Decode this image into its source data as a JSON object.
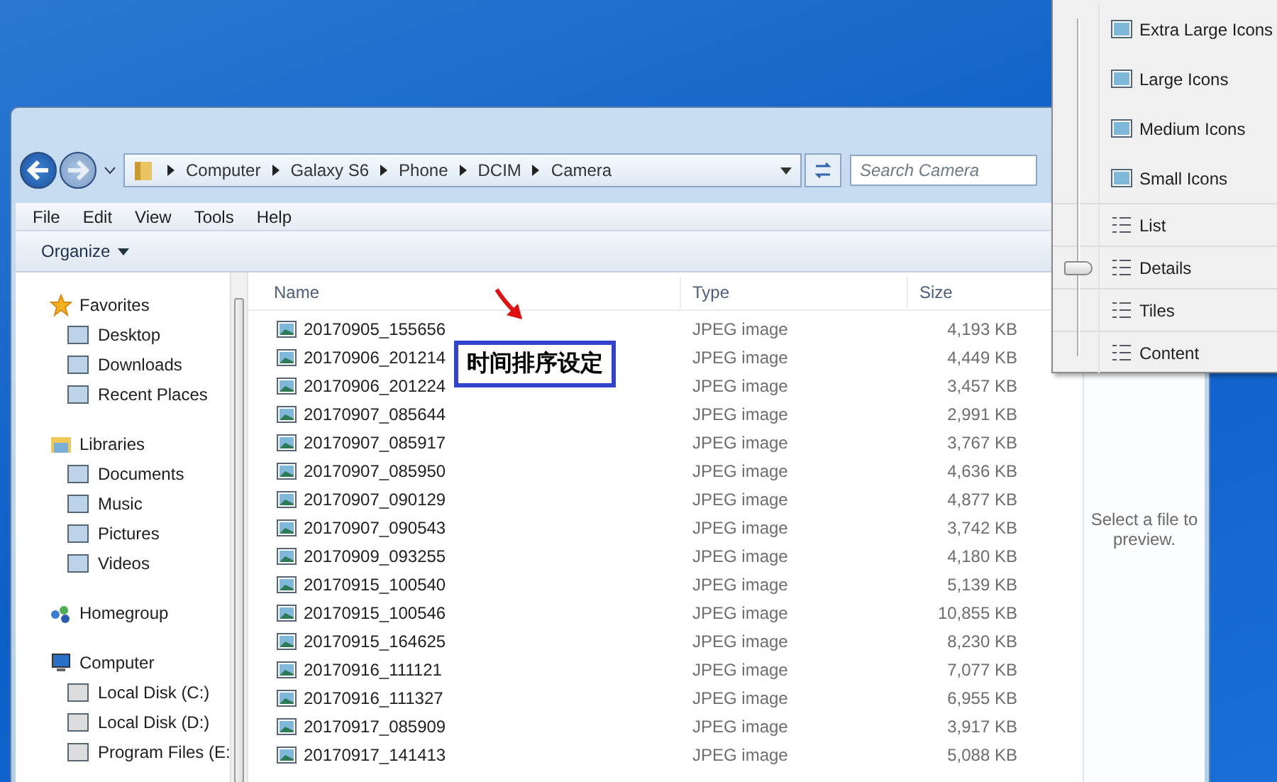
{
  "address_bar": {
    "path": [
      "Computer",
      "Galaxy S6",
      "Phone",
      "DCIM",
      "Camera"
    ]
  },
  "search": {
    "placeholder": "Search Camera"
  },
  "menu_bar": [
    "File",
    "Edit",
    "View",
    "Tools",
    "Help"
  ],
  "toolbar": {
    "organize": "Organize"
  },
  "nav_pane": [
    {
      "label": "Favorites",
      "children": [
        {
          "label": "Desktop"
        },
        {
          "label": "Downloads"
        },
        {
          "label": "Recent Places"
        }
      ]
    },
    {
      "label": "Libraries",
      "children": [
        {
          "label": "Documents"
        },
        {
          "label": "Music"
        },
        {
          "label": "Pictures"
        },
        {
          "label": "Videos"
        }
      ]
    },
    {
      "label": "Homegroup"
    },
    {
      "label": "Computer",
      "children": [
        {
          "label": "Local Disk (C:)"
        },
        {
          "label": "Local Disk (D:)"
        },
        {
          "label": "Program Files (E:"
        }
      ]
    }
  ],
  "table": {
    "columns": [
      "Name",
      "Type",
      "Size"
    ],
    "rows": [
      [
        "20170905_155656",
        "JPEG image",
        "4,193 KB"
      ],
      [
        "20170906_201214",
        "JPEG image",
        "4,449 KB"
      ],
      [
        "20170906_201224",
        "JPEG image",
        "3,457 KB"
      ],
      [
        "20170907_085644",
        "JPEG image",
        "2,991 KB"
      ],
      [
        "20170907_085917",
        "JPEG image",
        "3,767 KB"
      ],
      [
        "20170907_085950",
        "JPEG image",
        "4,636 KB"
      ],
      [
        "20170907_090129",
        "JPEG image",
        "4,877 KB"
      ],
      [
        "20170907_090543",
        "JPEG image",
        "3,742 KB"
      ],
      [
        "20170909_093255",
        "JPEG image",
        "4,180 KB"
      ],
      [
        "20170915_100540",
        "JPEG image",
        "5,139 KB"
      ],
      [
        "20170915_100546",
        "JPEG image",
        "10,855 KB"
      ],
      [
        "20170915_164625",
        "JPEG image",
        "8,230 KB"
      ],
      [
        "20170916_111121",
        "JPEG image",
        "7,077 KB"
      ],
      [
        "20170916_111327",
        "JPEG image",
        "6,955 KB"
      ],
      [
        "20170917_085909",
        "JPEG image",
        "3,917 KB"
      ],
      [
        "20170917_141413",
        "JPEG image",
        "5,088 KB"
      ]
    ]
  },
  "preview_pane": {
    "message": "Select a file to preview."
  },
  "annotation": {
    "text": "时间排序设定"
  },
  "view_menu": [
    {
      "label": "Extra Large Icons",
      "kind": "size",
      "selected": false
    },
    {
      "label": "Large Icons",
      "kind": "size",
      "selected": false
    },
    {
      "label": "Medium Icons",
      "kind": "size",
      "selected": false
    },
    {
      "label": "Small Icons",
      "kind": "size",
      "selected": false
    },
    {
      "label": "List",
      "kind": "layout",
      "selected": false
    },
    {
      "label": "Details",
      "kind": "layout",
      "selected": true
    },
    {
      "label": "Tiles",
      "kind": "layout",
      "selected": false
    },
    {
      "label": "Content",
      "kind": "layout",
      "selected": false
    }
  ]
}
